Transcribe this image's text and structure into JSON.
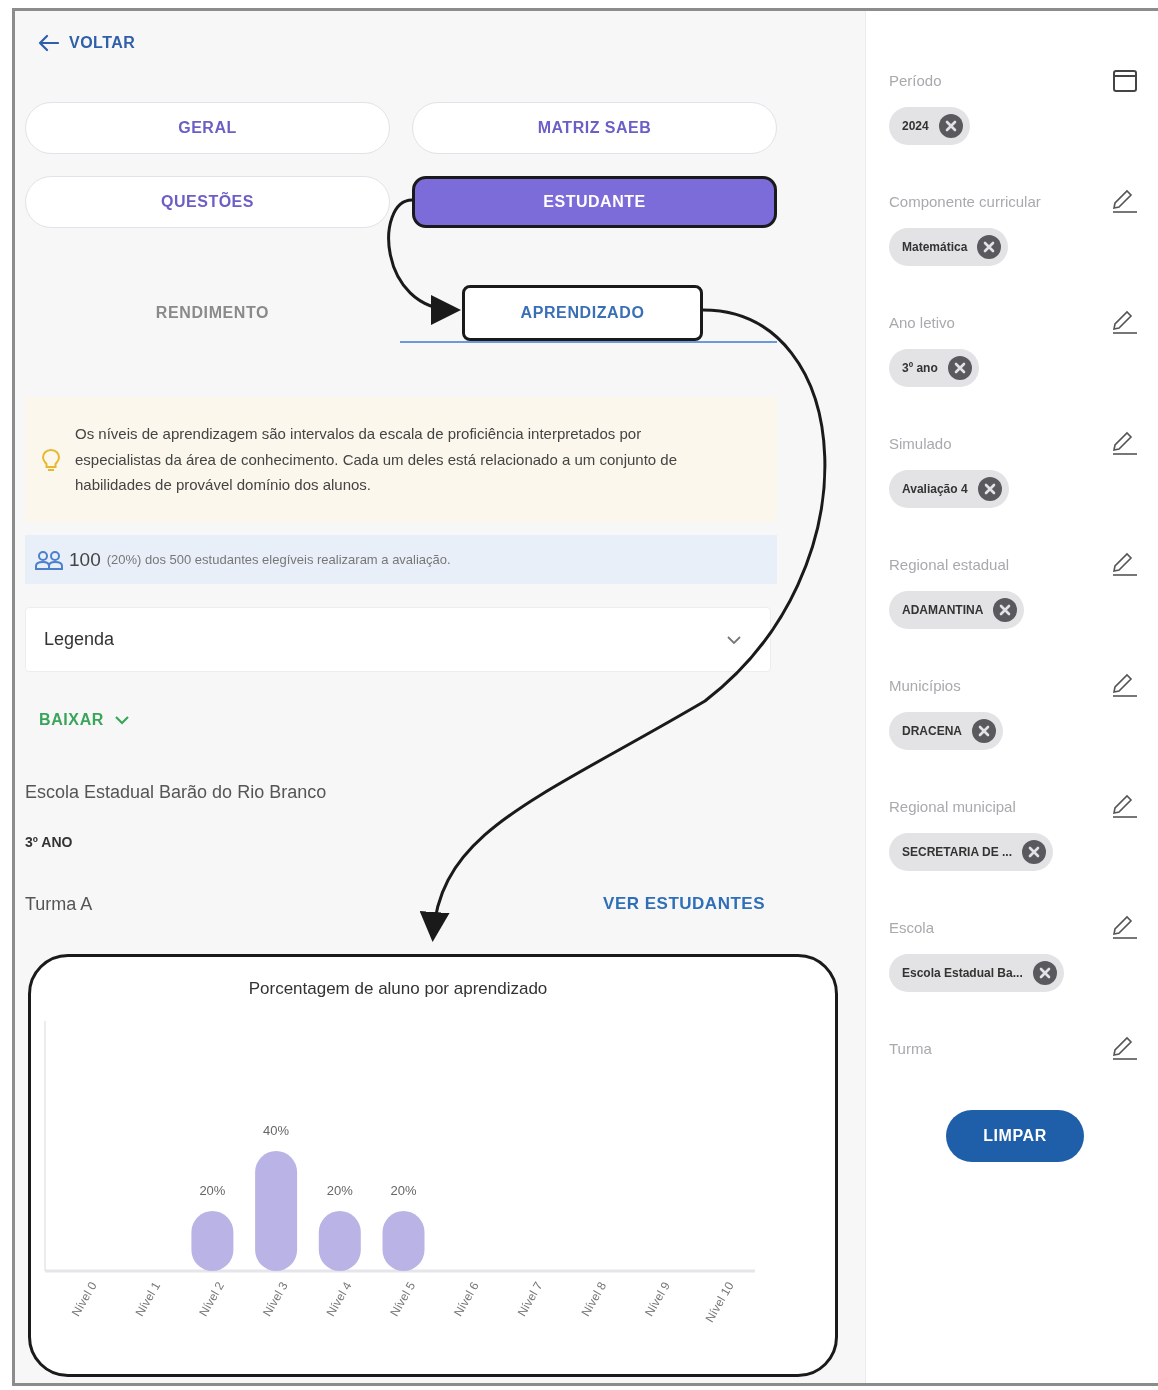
{
  "back_link": {
    "label": "VOLTAR"
  },
  "tabs": [
    {
      "label": "GERAL",
      "selected": false,
      "annotated": false
    },
    {
      "label": "MATRIZ SAEB",
      "selected": false,
      "annotated": false
    },
    {
      "label": "QUESTÕES",
      "selected": false,
      "annotated": false
    },
    {
      "label": "ESTUDANTE",
      "selected": true,
      "annotated": true
    }
  ],
  "subtabs": [
    {
      "label": "RENDIMENTO",
      "selected": false,
      "annotated": false
    },
    {
      "label": "APRENDIZADO",
      "selected": true,
      "annotated": true
    }
  ],
  "info_note": "Os níveis de aprendizagem são intervalos da escala de proficiência interpretados por especialistas da área de conhecimento. Cada um deles está relacionado a um conjunto de habilidades de provável domínio dos alunos.",
  "stats": {
    "count": "100",
    "text": "(20%) dos 500 estudantes elegíveis realizaram a avaliação."
  },
  "legend_dropdown": {
    "label": "Legenda"
  },
  "download": {
    "label": "BAIXAR"
  },
  "school": {
    "name": "Escola Estadual Barão do Rio Branco",
    "grade": "3º ANO",
    "class": "Turma A",
    "action": "VER ESTUDANTES"
  },
  "chart": {
    "annotated": true,
    "chart_data": {
      "type": "bar",
      "title": "Porcentagem de aluno por aprendizado",
      "categories": [
        "Nível 0",
        "Nível 1",
        "Nível 2",
        "Nível 3",
        "Nível 4",
        "Nível 5",
        "Nível 6",
        "Nível 7",
        "Nível 8",
        "Nível 9",
        "Nível 10"
      ],
      "values": [
        0,
        0,
        20,
        40,
        20,
        20,
        0,
        0,
        0,
        0,
        0
      ],
      "value_labels": [
        null,
        null,
        "20%",
        "40%",
        "20%",
        "20%",
        null,
        null,
        null,
        null,
        null
      ]
    }
  },
  "filters": [
    {
      "label": "Período",
      "kind": "date",
      "chip": "2024"
    },
    {
      "label": "Componente curricular",
      "kind": "select",
      "chip": "Matemática"
    },
    {
      "label": "Ano letivo",
      "kind": "select",
      "chip": "3º ano"
    },
    {
      "label": "Simulado",
      "kind": "select",
      "chip": "Avaliação 4"
    },
    {
      "label": "Regional estadual",
      "kind": "select",
      "chip": "ADAMANTINA"
    },
    {
      "label": "Municípios",
      "kind": "select",
      "chip": "DRACENA"
    },
    {
      "label": "Regional municipal",
      "kind": "select",
      "chip": "SECRETARIA DE ..."
    },
    {
      "label": "Escola",
      "kind": "select",
      "chip": "Escola Estadual Ba..."
    },
    {
      "label": "Turma",
      "kind": "select"
    }
  ],
  "clear_button": {
    "label": "LIMPAR"
  }
}
